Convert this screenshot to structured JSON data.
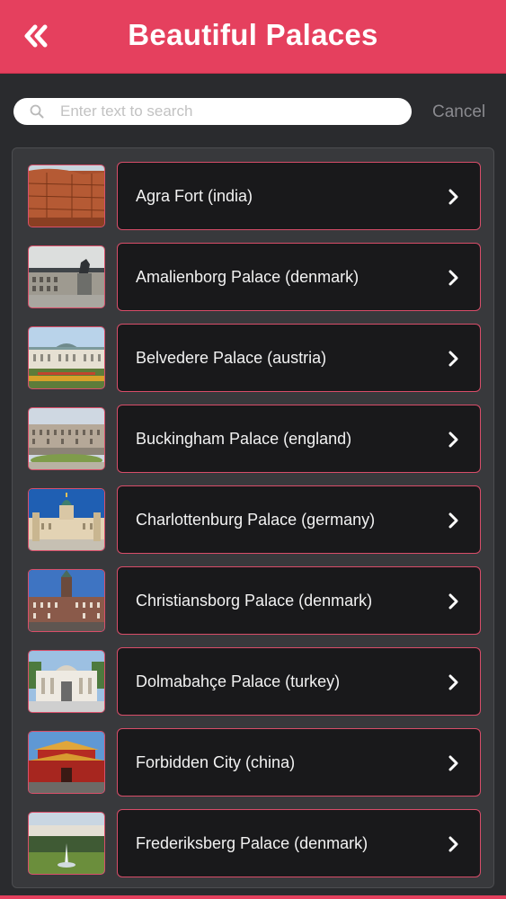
{
  "header": {
    "title": "Beautiful Palaces",
    "back_icon": "double-chevron-left-icon",
    "background_color": "#e5405e"
  },
  "search": {
    "placeholder": "Enter text to search",
    "value": "",
    "cancel_label": "Cancel",
    "icon": "search-icon"
  },
  "items": [
    {
      "label": "Agra Fort (india)"
    },
    {
      "label": "Amalienborg Palace (denmark)"
    },
    {
      "label": "Belvedere Palace (austria)"
    },
    {
      "label": "Buckingham Palace (england)"
    },
    {
      "label": "Charlottenburg Palace (germany)"
    },
    {
      "label": "Christiansborg Palace (denmark)"
    },
    {
      "label": "Dolmabahçe Palace (turkey)"
    },
    {
      "label": "Forbidden City (china)"
    },
    {
      "label": "Frederiksberg Palace (denmark)"
    }
  ],
  "colors": {
    "accent": "#e5405e",
    "item_background": "#19191b",
    "panel_background": "#38393c",
    "page_background": "#2a2b2e"
  }
}
